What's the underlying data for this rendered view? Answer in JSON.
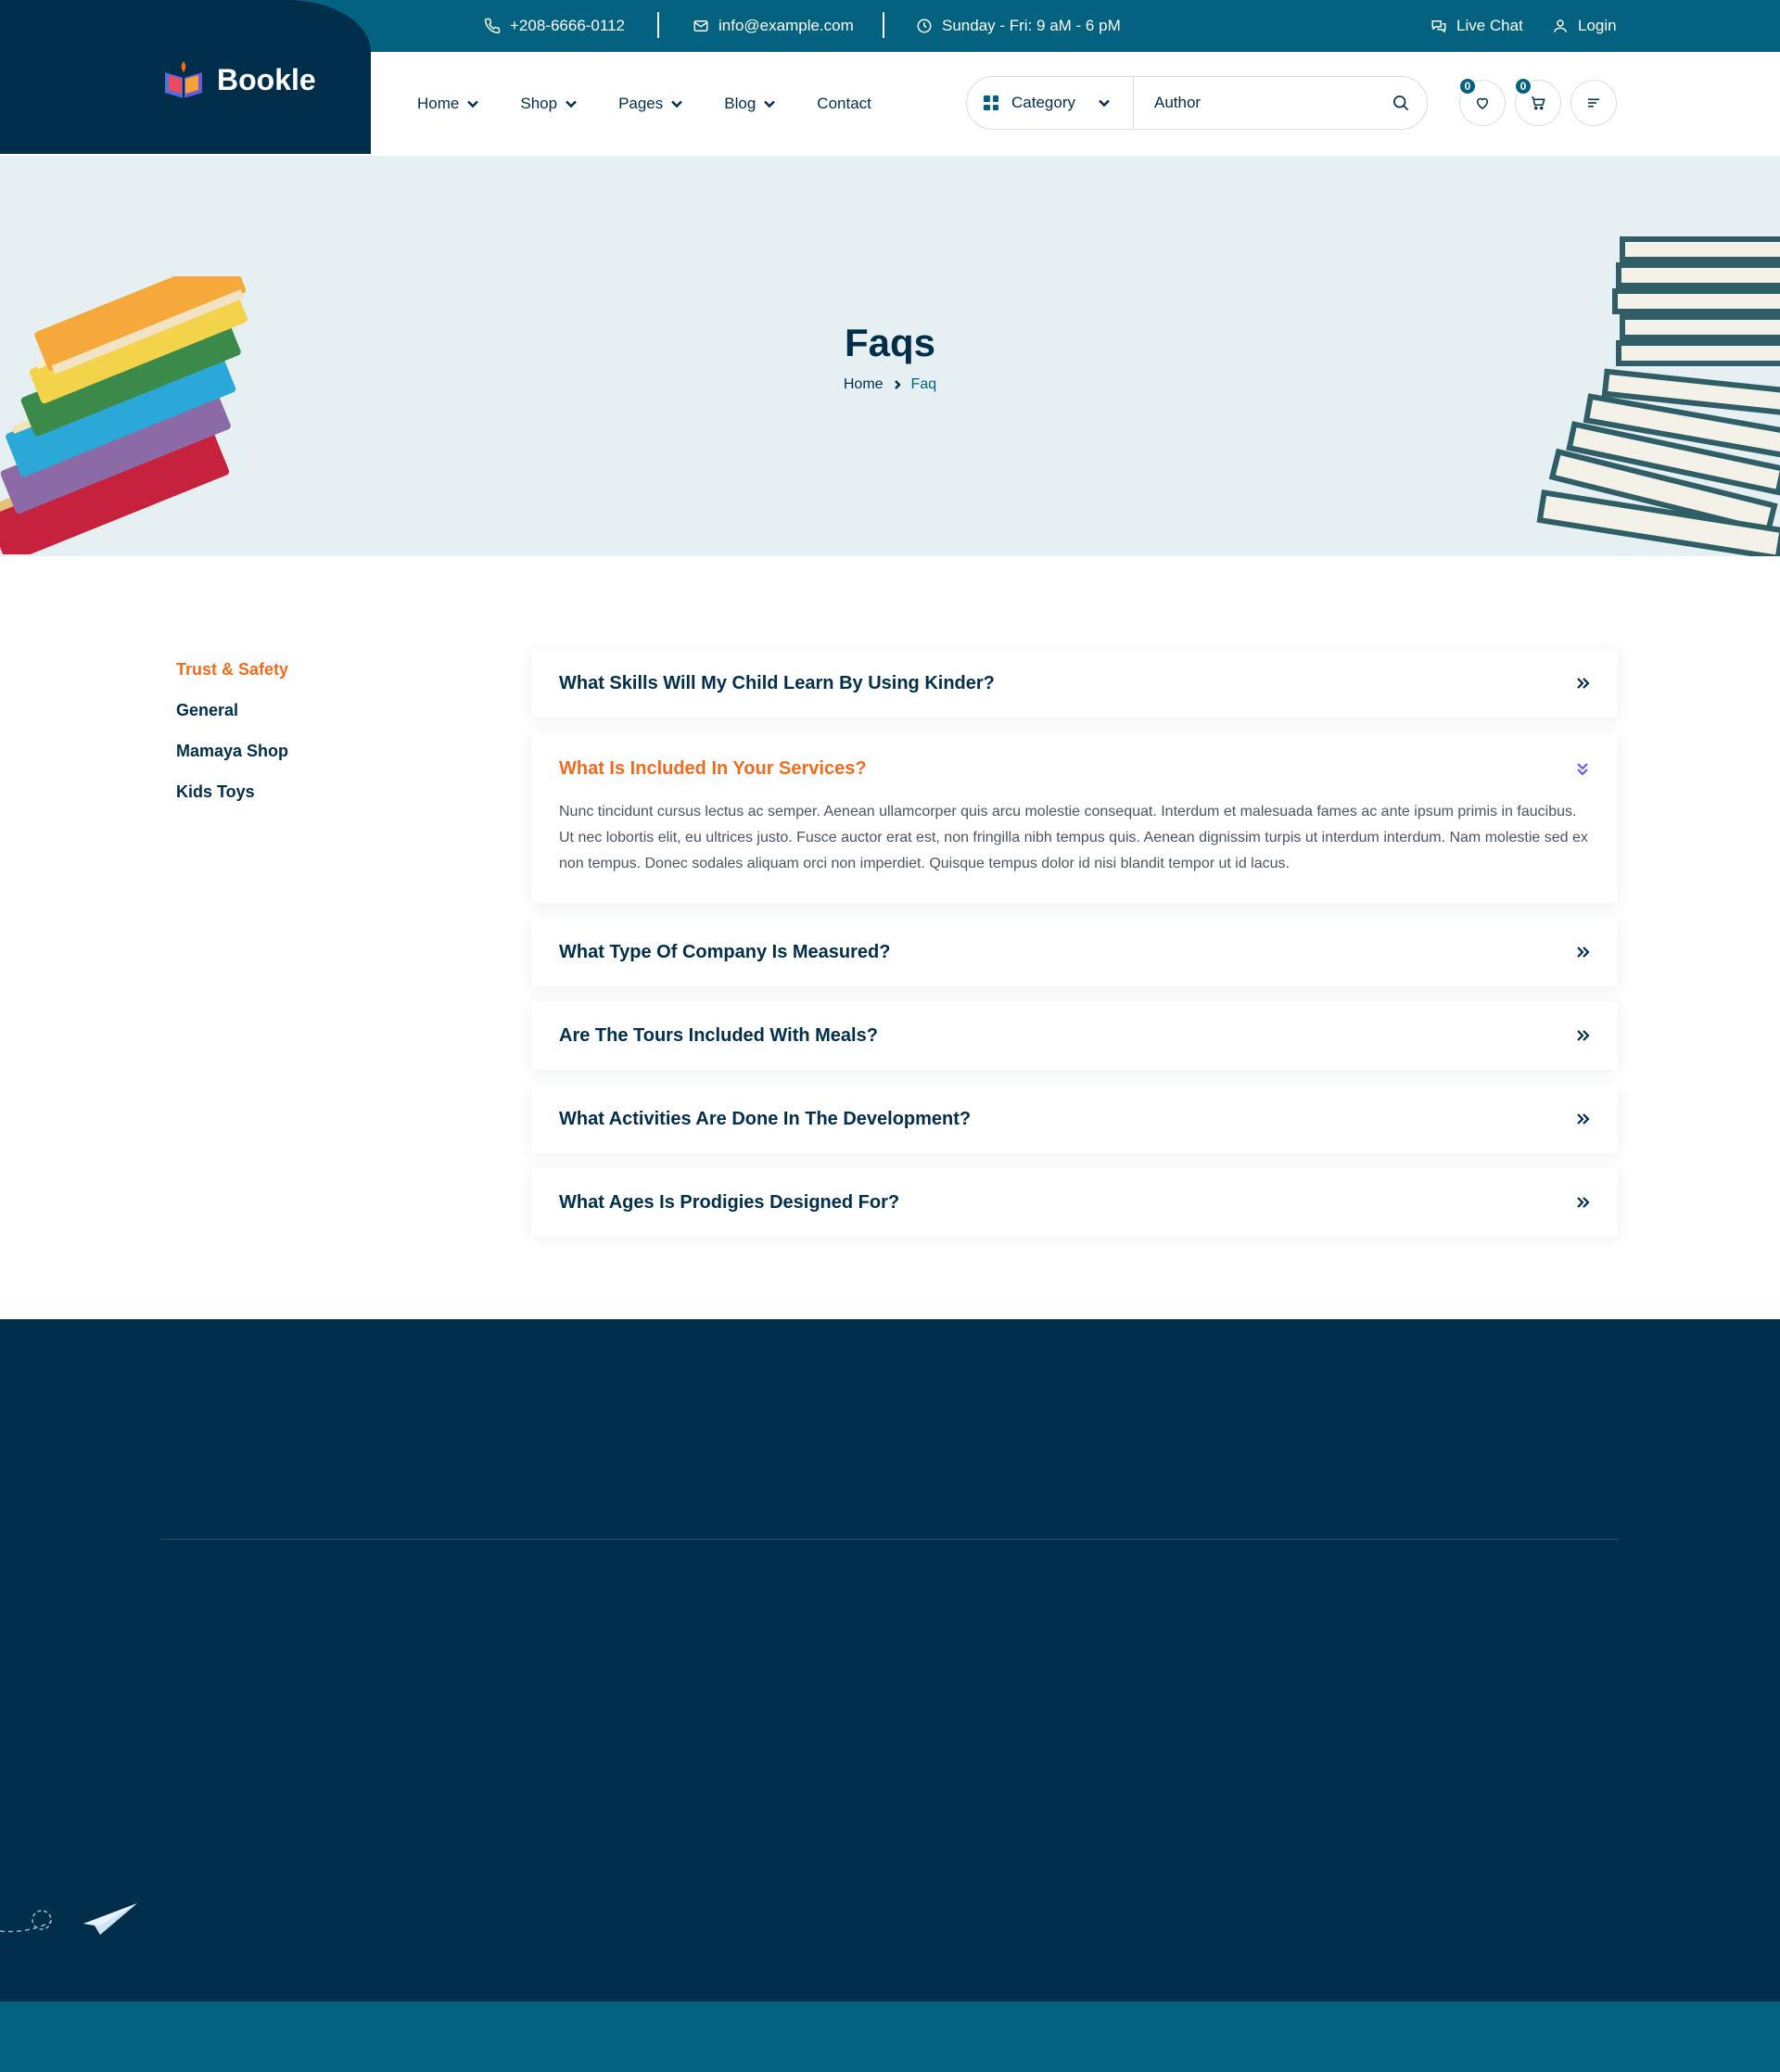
{
  "topbar": {
    "phone": "+208-6666-0112",
    "email": "info@example.com",
    "hours": "Sunday - Fri: 9 aM - 6 pM",
    "live_chat": "Live Chat",
    "login": "Login"
  },
  "brand": {
    "name": "Bookle"
  },
  "nav": {
    "items": [
      {
        "label": "Home"
      },
      {
        "label": "Shop"
      },
      {
        "label": "Pages"
      },
      {
        "label": "Blog"
      },
      {
        "label": "Contact"
      }
    ]
  },
  "search": {
    "category_label": "Category",
    "placeholder": "Author"
  },
  "header_icons": {
    "wishlist_count": "0",
    "cart_count": "0"
  },
  "hero": {
    "title": "Faqs",
    "breadcrumb_home": "Home",
    "breadcrumb_current": "Faq"
  },
  "faq_categories": [
    {
      "label": "Trust & Safety"
    },
    {
      "label": "General"
    },
    {
      "label": "Mamaya Shop"
    },
    {
      "label": "Kids Toys"
    }
  ],
  "faqs": [
    {
      "question": "What Skills Will My Child Learn By Using Kinder?"
    },
    {
      "question": "What Is Included In Your Services?",
      "answer": "Nunc tincidunt cursus lectus ac semper. Aenean ullamcorper quis arcu molestie consequat. Interdum et malesuada fames ac ante ipsum primis in faucibus. Ut nec lobortis elit, eu ultrices justo. Fusce auctor erat est, non fringilla nibh tempus quis. Aenean dignissim turpis ut interdum interdum. Nam molestie sed ex non tempus. Donec sodales aliquam orci non imperdiet. Quisque tempus dolor id nisi blandit tempor ut id lacus."
    },
    {
      "question": "What Type Of Company Is Measured?"
    },
    {
      "question": "Are The Tours Included With Meals?"
    },
    {
      "question": "What Activities Are Done In The Development?"
    },
    {
      "question": "What Ages Is Prodigies Designed For?"
    }
  ],
  "colors": {
    "primary_dark": "#012e4a",
    "primary": "#036280",
    "accent": "#f26b1d",
    "hero_bg": "#e6eff1"
  },
  "icons": {
    "phone": "phone-icon",
    "email": "mail-icon",
    "clock": "clock-icon",
    "chat": "chat-icon",
    "user": "user-icon",
    "search": "search-icon",
    "heart": "heart-icon",
    "cart": "cart-icon",
    "menu": "menu-icon"
  }
}
